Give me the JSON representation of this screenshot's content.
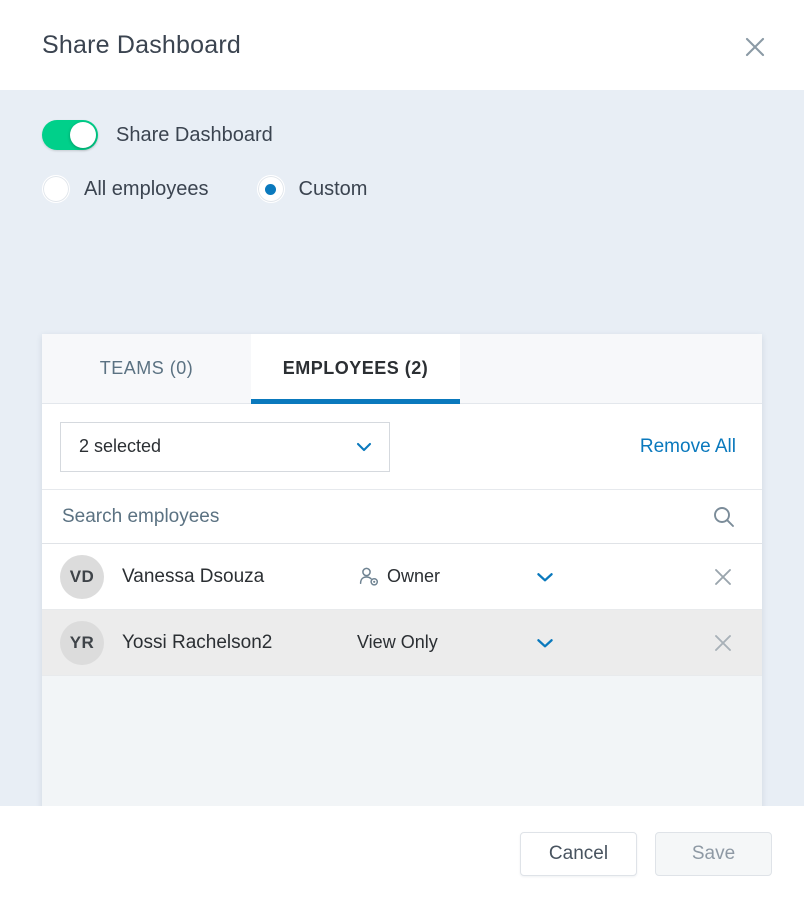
{
  "header": {
    "title": "Share Dashboard",
    "close_icon": "close-icon"
  },
  "body": {
    "share_toggle": {
      "label": "Share Dashboard",
      "on": true,
      "on_color": "#00d08a"
    },
    "audience": {
      "options": [
        {
          "label": "All employees",
          "selected": false
        },
        {
          "label": "Custom",
          "selected": true
        }
      ],
      "accent_color": "#0a79bd"
    },
    "panel": {
      "tabs": [
        {
          "label": "TEAMS (0)",
          "active": false
        },
        {
          "label": "EMPLOYEES (2)",
          "active": true
        }
      ],
      "active_tab_underline_color": "#0a79bd",
      "selector": {
        "value": "2 selected",
        "chevron_icon": "chevron-down-icon",
        "remove_all_label": "Remove All",
        "remove_all_color": "#0a79bd"
      },
      "search": {
        "value": "",
        "placeholder": "Search employees",
        "icon": "search-icon"
      },
      "rows": [
        {
          "initials": "VD",
          "name": "Vanessa Dsouza",
          "role": "Owner",
          "role_icon": "user-gear-icon",
          "chevron_icon": "chevron-down-icon",
          "remove_icon": "close-icon",
          "hovered": false
        },
        {
          "initials": "YR",
          "name": "Yossi Rachelson2",
          "role": "View Only",
          "role_icon": "",
          "chevron_icon": "chevron-down-icon",
          "remove_icon": "close-icon",
          "hovered": true
        }
      ]
    }
  },
  "footer": {
    "cancel_label": "Cancel",
    "save_label": "Save"
  }
}
